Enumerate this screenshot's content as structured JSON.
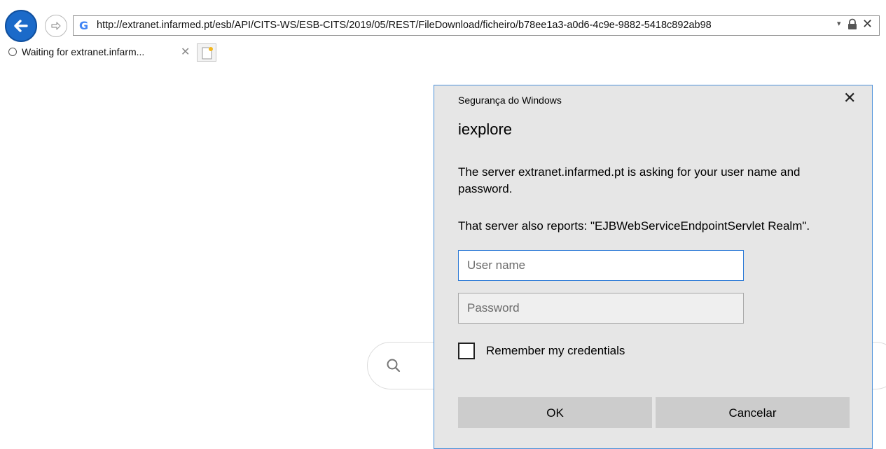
{
  "browser": {
    "url": "http://extranet.infarmed.pt/esb/API/CITS-WS/ESB-CITS/2019/05/REST/FileDownload/ficheiro/b78ee1a3-a0d6-4c9e-9882-5418c892ab98",
    "address_icon": "google-g-icon",
    "address_dropdown_glyph": "▾",
    "stop_glyph": "✕",
    "tab_title": "Waiting for extranet.infarm...",
    "tab_close_glyph": "✕"
  },
  "dialog": {
    "caption": "Segurança do Windows",
    "close_glyph": "✕",
    "title": "iexplore",
    "message": "The server extranet.infarmed.pt is asking for your user name and password.",
    "realm": "That server also reports: \"EJBWebServiceEndpointServlet Realm\".",
    "username": {
      "value": "",
      "placeholder": "User name"
    },
    "password": {
      "value": "",
      "placeholder": "Password"
    },
    "remember_label": "Remember my credentials",
    "remember_checked": false,
    "ok_label": "OK",
    "cancel_label": "Cancelar"
  },
  "colors": {
    "back_button": "#1b6ac9",
    "dialog_border": "#4a90d9",
    "dialog_bg": "#e6e6e6",
    "button_bg": "#cccccc"
  }
}
